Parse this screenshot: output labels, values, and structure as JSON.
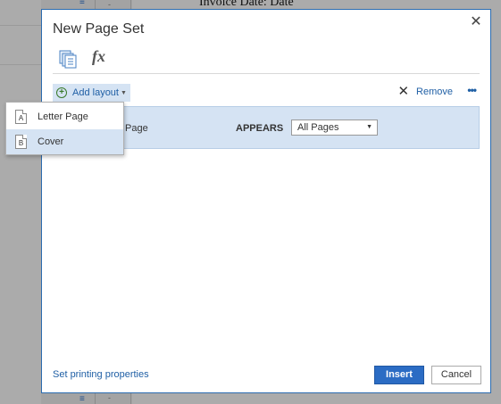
{
  "background": {
    "document_text": "Invoice Date: Date",
    "menu_glyph": "≡",
    "dot_glyph": "-"
  },
  "dialog": {
    "title": "New Page Set",
    "close_glyph": "✕",
    "tabs": [
      {
        "name": "layout-tab",
        "icon": "page-layout-icon"
      },
      {
        "name": "fx-tab",
        "label": "fx"
      }
    ],
    "toolbar": {
      "add_icon": "+",
      "add_label": "Add layout",
      "remove_icon": "✕",
      "remove_label": "Remove",
      "more_glyph": "•••"
    },
    "row": {
      "page_label": "Page",
      "appears_label": "APPEARS",
      "appears_value": "All Pages"
    },
    "footer": {
      "link": "Set printing properties",
      "insert_label": "Insert",
      "cancel_label": "Cancel"
    }
  },
  "dropdown": {
    "items": [
      {
        "glyph": "A",
        "label": "Letter Page",
        "selected": false
      },
      {
        "glyph": "B",
        "label": "Cover",
        "selected": true
      }
    ]
  },
  "colors": {
    "accent": "#2b6cc4",
    "link": "#1f5fa5",
    "selection": "#d5e3f3"
  }
}
